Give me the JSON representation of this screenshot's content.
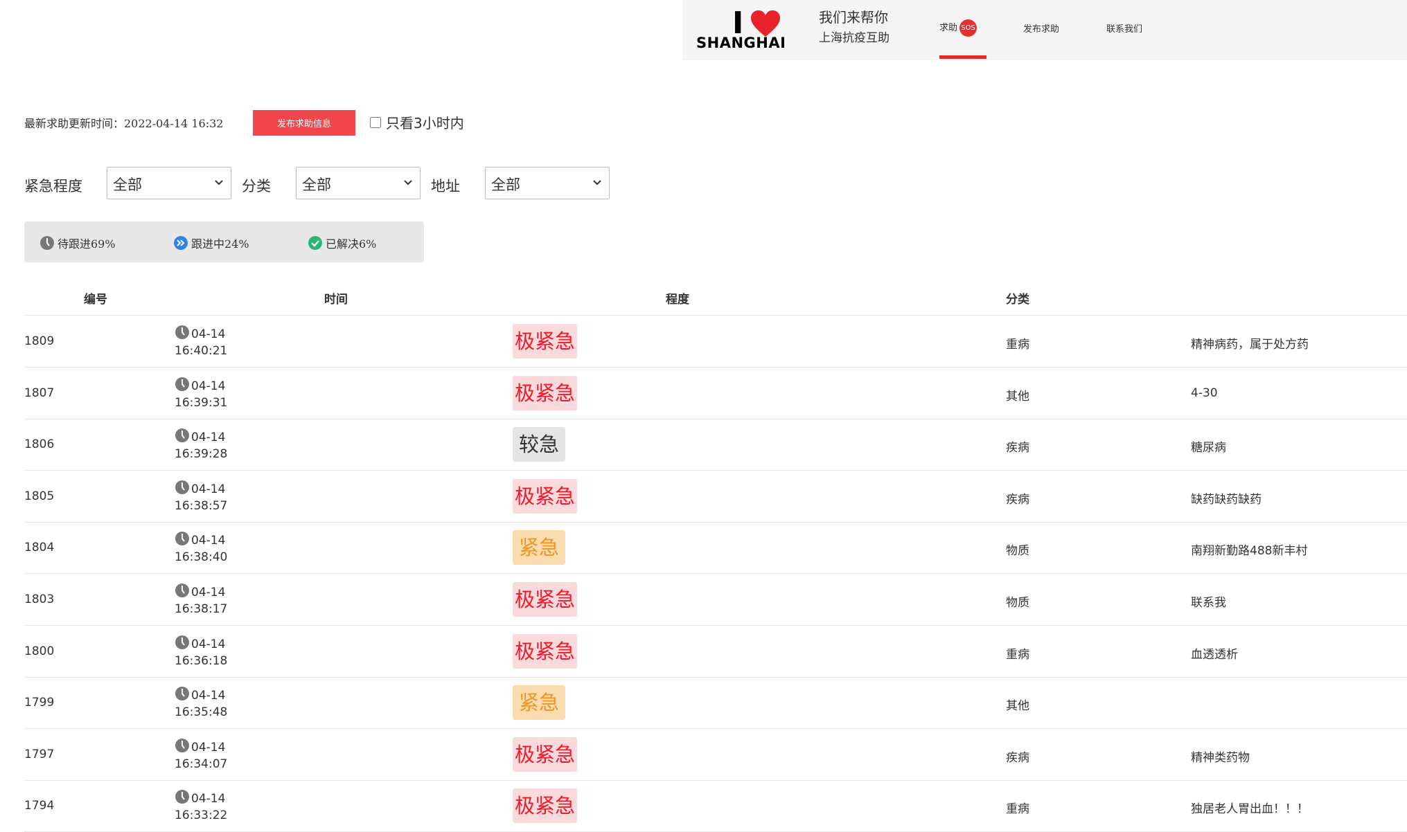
{
  "header": {
    "logo_i": "I",
    "logo_word": "SHANGHAI",
    "tagline_1": "我们来帮你",
    "tagline_2": "上海抗疫互助",
    "nav": {
      "help": "求助",
      "sos": "SOS",
      "post": "发布求助",
      "contact": "联系我们"
    },
    "accent": "#e32b2b"
  },
  "toolbar": {
    "updated": "最新求助更新时间：2022-04-14 16:32",
    "publish_button": "发布求助信息",
    "only_3h": "只看3小时内",
    "only_3h_checked": false
  },
  "filters": {
    "urgency_label": "紧急程度",
    "urgency_value": "全部",
    "category_label": "分类",
    "category_value": "全部",
    "address_label": "地址",
    "address_value": "全部"
  },
  "status": {
    "pending": "待跟进69%",
    "in_progress": "跟进中24%",
    "resolved": "已解决6%"
  },
  "table": {
    "headers": {
      "id": "编号",
      "time": "时间",
      "level": "程度",
      "category": "分类"
    },
    "rows": [
      {
        "id": "1809",
        "date": "04-14",
        "time": "16:40:21",
        "level": "极紧急",
        "level_class": "critical",
        "category": "重病",
        "note": "精神病药，属于处方药"
      },
      {
        "id": "1807",
        "date": "04-14",
        "time": "16:39:31",
        "level": "极紧急",
        "level_class": "critical",
        "category": "其他",
        "note": "4-30"
      },
      {
        "id": "1806",
        "date": "04-14",
        "time": "16:39:28",
        "level": "较急",
        "level_class": "high",
        "category": "疾病",
        "note": "糖尿病"
      },
      {
        "id": "1805",
        "date": "04-14",
        "time": "16:38:57",
        "level": "极紧急",
        "level_class": "critical",
        "category": "疾病",
        "note": "缺药缺药缺药"
      },
      {
        "id": "1804",
        "date": "04-14",
        "time": "16:38:40",
        "level": "紧急",
        "level_class": "urgent",
        "category": "物质",
        "note": "南翔新勤路488新丰村"
      },
      {
        "id": "1803",
        "date": "04-14",
        "time": "16:38:17",
        "level": "极紧急",
        "level_class": "critical",
        "category": "物质",
        "note": "联系我"
      },
      {
        "id": "1800",
        "date": "04-14",
        "time": "16:36:18",
        "level": "极紧急",
        "level_class": "critical",
        "category": "重病",
        "note": "血透透析"
      },
      {
        "id": "1799",
        "date": "04-14",
        "time": "16:35:48",
        "level": "紧急",
        "level_class": "urgent",
        "category": "其他",
        "note": ""
      },
      {
        "id": "1797",
        "date": "04-14",
        "time": "16:34:07",
        "level": "极紧急",
        "level_class": "critical",
        "category": "疾病",
        "note": "精神类药物"
      },
      {
        "id": "1794",
        "date": "04-14",
        "time": "16:33:22",
        "level": "极紧急",
        "level_class": "critical",
        "category": "重病",
        "note": "独居老人胃出血！！！"
      }
    ]
  }
}
